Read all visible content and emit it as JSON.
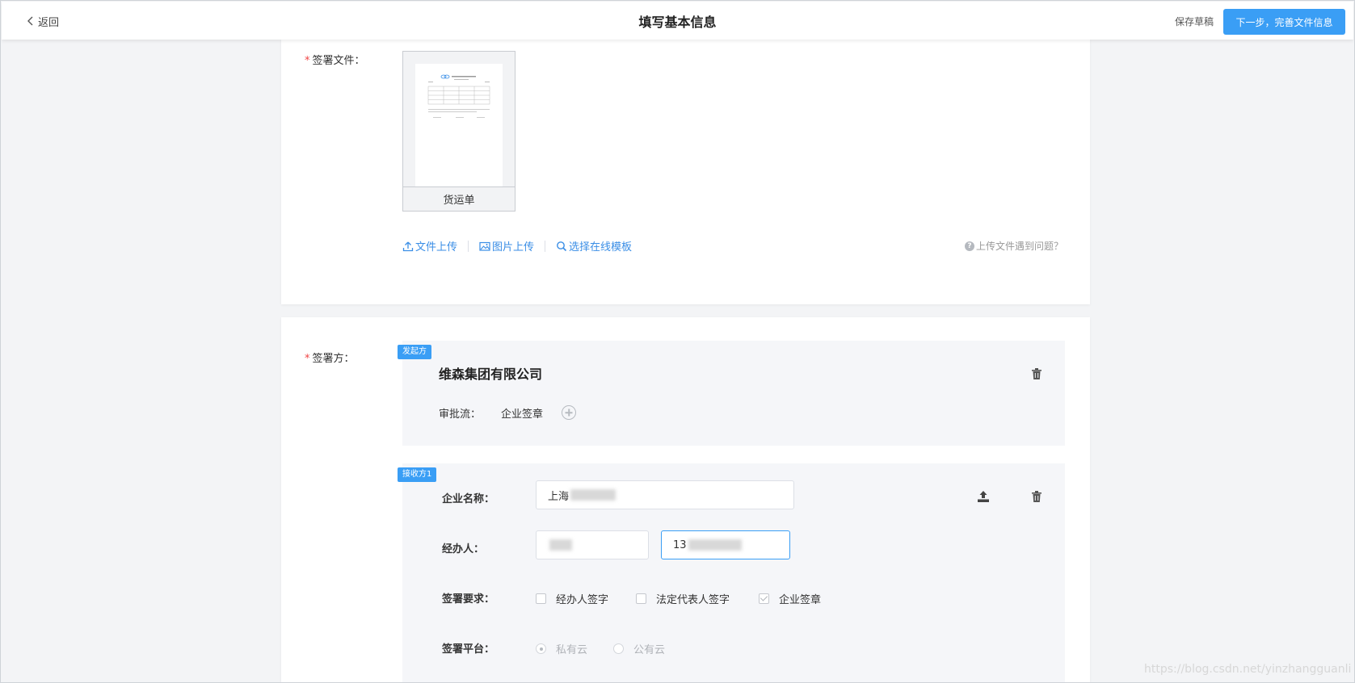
{
  "header": {
    "back_label": "返回",
    "title": "填写基本信息",
    "save_draft_label": "保存草稿",
    "next_label": "下一步，完善文件信息",
    "accent_color": "#3a9ef5"
  },
  "file_section": {
    "label": "签署文件：",
    "file_name": "货运单",
    "actions": [
      {
        "label": "文件上传",
        "icon": "upload-icon"
      },
      {
        "label": "图片上传",
        "icon": "image-icon"
      },
      {
        "label": "选择在线模板",
        "icon": "search-icon"
      }
    ],
    "help_label": "上传文件遇到问题？"
  },
  "signatory_section": {
    "label": "签署方：",
    "initiator": {
      "tag": "发起方",
      "company": "维森集团有限公司",
      "flow_label": "审批流：",
      "flow_value": "企业签章"
    },
    "receiver": {
      "tag": "接收方1",
      "company_label": "企业名称：",
      "company_value": "上海",
      "handler_label": "经办人：",
      "handler_phone": "13",
      "requirement_label": "签署要求：",
      "requirements": [
        {
          "label": "经办人签字",
          "checked": false
        },
        {
          "label": "法定代表人签字",
          "checked": false
        },
        {
          "label": "企业签章",
          "checked": true
        }
      ],
      "platform_label": "签署平台：",
      "platforms": [
        {
          "label": "私有云",
          "selected": true
        },
        {
          "label": "公有云",
          "selected": false
        }
      ]
    }
  },
  "watermark": "https://blog.csdn.net/yinzhangguanli"
}
